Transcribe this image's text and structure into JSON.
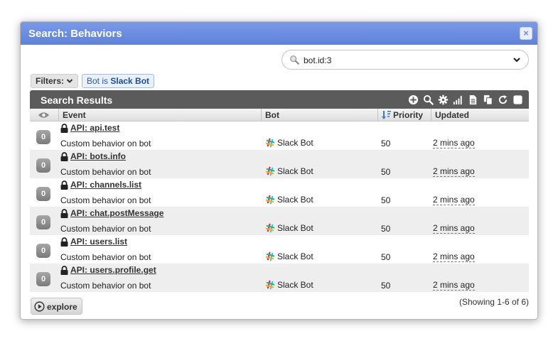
{
  "dialog": {
    "title": "Search: Behaviors",
    "close_label": "×"
  },
  "query": {
    "value": "bot.id:3",
    "icon": "search-icon"
  },
  "filters": {
    "label": "Filters:",
    "chip_prefix": "Bot is ",
    "chip_value": "Slack Bot"
  },
  "results": {
    "title": "Search Results",
    "toolbar_icons": [
      "add-icon",
      "search-icon",
      "gear-icon",
      "signal-icon",
      "export-icon",
      "copy-icon",
      "refresh-icon",
      "select-all-icon"
    ],
    "columns": {
      "event": "Event",
      "bot": "Bot",
      "priority": "Priority",
      "updated": "Updated"
    },
    "rows": [
      {
        "count": "0",
        "name": "API: api.test",
        "desc": "Custom behavior on bot",
        "bot": "Slack Bot",
        "priority": "50",
        "updated": "2 mins ago"
      },
      {
        "count": "0",
        "name": "API: bots.info",
        "desc": "Custom behavior on bot",
        "bot": "Slack Bot",
        "priority": "50",
        "updated": "2 mins ago"
      },
      {
        "count": "0",
        "name": "API: channels.list",
        "desc": "Custom behavior on bot",
        "bot": "Slack Bot",
        "priority": "50",
        "updated": "2 mins ago"
      },
      {
        "count": "0",
        "name": "API: chat.postMessage",
        "desc": "Custom behavior on bot",
        "bot": "Slack Bot",
        "priority": "50",
        "updated": "2 mins ago"
      },
      {
        "count": "0",
        "name": "API: users.list",
        "desc": "Custom behavior on bot",
        "bot": "Slack Bot",
        "priority": "50",
        "updated": "2 mins ago"
      },
      {
        "count": "0",
        "name": "API: users.profile.get",
        "desc": "Custom behavior on bot",
        "bot": "Slack Bot",
        "priority": "50",
        "updated": "2 mins ago"
      }
    ]
  },
  "footer": {
    "explore_label": "explore",
    "showing": "(Showing 1-6 of 6)"
  },
  "colors": {
    "titlebar": "#6e8fe0",
    "results_header": "#5b5b5b",
    "chip_text": "#2a5aa8"
  }
}
